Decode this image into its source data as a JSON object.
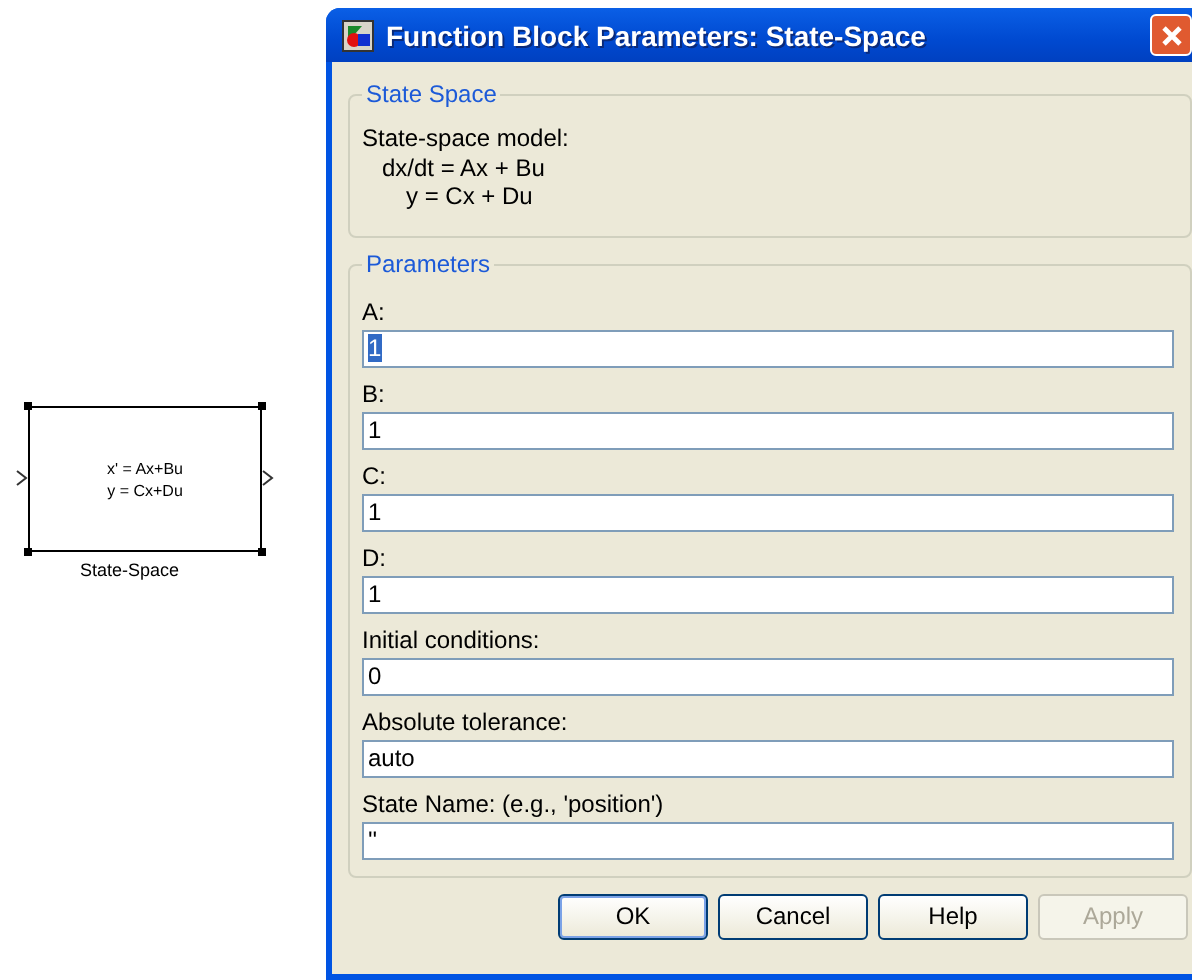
{
  "diagram": {
    "block": {
      "lines": [
        "x' = Ax+Bu",
        "y = Cx+Du"
      ],
      "name": "State-Space"
    }
  },
  "window": {
    "title": "Function Block Parameters: State-Space"
  },
  "description": {
    "heading": "State Space",
    "lines": [
      "State-space model:",
      "dx/dt = Ax + Bu",
      "y = Cx + Du"
    ]
  },
  "parameters": {
    "heading": "Parameters",
    "fields": [
      {
        "label": "A:",
        "value": "1",
        "selected": true
      },
      {
        "label": "B:",
        "value": "1",
        "selected": false
      },
      {
        "label": "C:",
        "value": "1",
        "selected": false
      },
      {
        "label": "D:",
        "value": "1",
        "selected": false
      },
      {
        "label": "Initial conditions:",
        "value": "0",
        "selected": false
      },
      {
        "label": "Absolute tolerance:",
        "value": "auto",
        "selected": false
      },
      {
        "label": "State Name: (e.g., 'position')",
        "value": "''",
        "selected": false
      }
    ]
  },
  "buttons": [
    {
      "label": "OK",
      "disabled": false,
      "default": true
    },
    {
      "label": "Cancel",
      "disabled": false,
      "default": false
    },
    {
      "label": "Help",
      "disabled": false,
      "default": false
    },
    {
      "label": "Apply",
      "disabled": true,
      "default": false
    }
  ]
}
